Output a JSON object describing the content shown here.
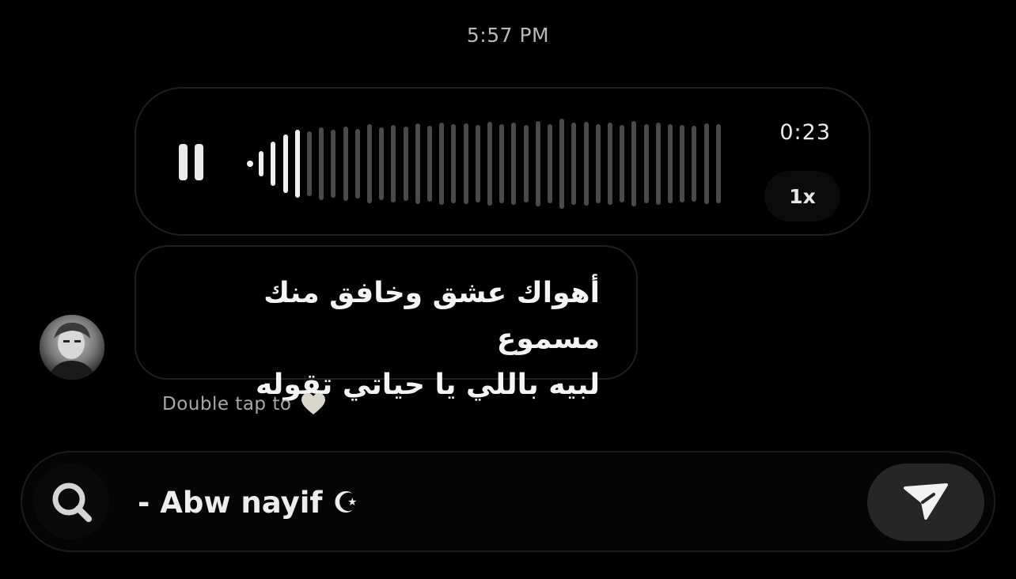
{
  "thread": {
    "timestamp": "5:57 PM"
  },
  "voice_message": {
    "duration": "0:23",
    "speed": "1x",
    "state_icon": "pause-icon",
    "progress": 0.1,
    "colors": {
      "played": "#f0f0f0",
      "unplayed": "#4a4a4a"
    }
  },
  "text_message": {
    "line1": "أهواك عشق وخافق منك مسموع",
    "line2": "لبيه باللي يا حياتي تقوله"
  },
  "reaction_hint": {
    "label": "Double tap to",
    "icon": "heart-icon"
  },
  "composer": {
    "value": "- Abw nayif ☪︎",
    "search_icon": "search-icon",
    "send_icon": "send-icon"
  }
}
